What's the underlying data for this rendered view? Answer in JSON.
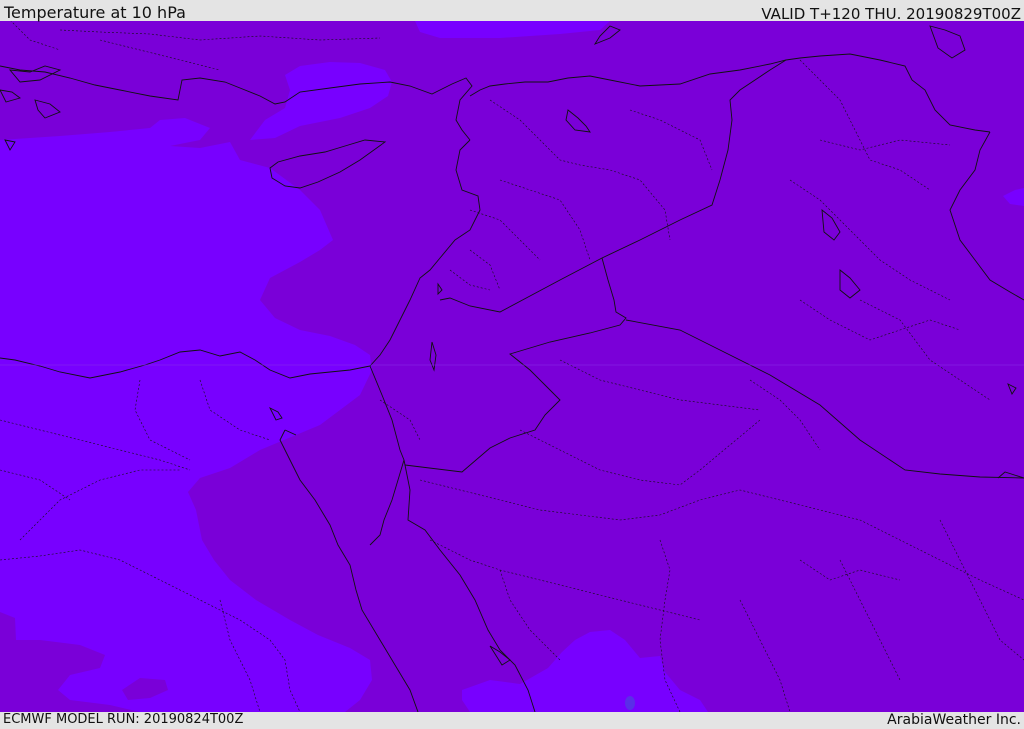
{
  "header": {
    "title": "Temperature at 10 hPa",
    "valid_time": "VALID T+120 THU. 20190829T00Z"
  },
  "footer": {
    "model_run": "ECMWF MODEL RUN: 20190824T00Z",
    "credit": "ArabiaWeather Inc."
  },
  "colors": {
    "warmer_fill": "#7a00d8",
    "colder_fill": "#7800ff",
    "blue_patch": "#5a2ee8",
    "boundary_line": "#111111",
    "chrome_background": "#e4e4e4"
  },
  "map": {
    "variable": "temperature",
    "level": "10 hPa",
    "region": "Eastern Mediterranean and Middle East"
  }
}
